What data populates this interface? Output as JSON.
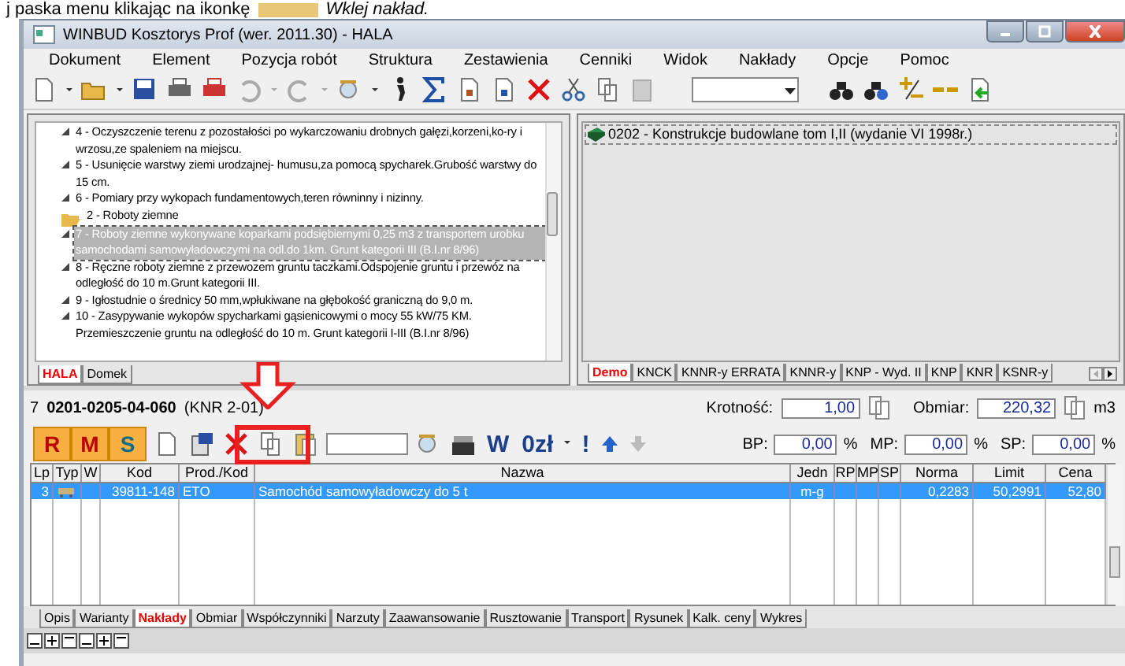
{
  "caption": {
    "before": "j paska menu klikając na ikonkę",
    "after": "Wklej nakład."
  },
  "window": {
    "title": "WINBUD Kosztorys Prof (wer. 2011.30) - HALA"
  },
  "menu": [
    "Dokument",
    "Element",
    "Pozycja robót",
    "Struktura",
    "Zestawienia",
    "Cenniki",
    "Widok",
    "Nakłady",
    "Opcje",
    "Pomoc"
  ],
  "tree": [
    {
      "kind": "item",
      "label": "4 - Oczyszczenie terenu z pozostałości po wykarczowaniu drobnych gałęzi,korzeni,ko-ry i wrzosu,ze spaleniem na miejscu.",
      "selected": false
    },
    {
      "kind": "item",
      "label": "5 - Usunięcie warstwy ziemi urodzajnej- humusu,za pomocą spycharek.Grubość warstwy do 15 cm.",
      "selected": false
    },
    {
      "kind": "item",
      "label": "6 - Pomiary przy wykopach fundamentowych,teren równinny i nizinny.",
      "selected": false
    },
    {
      "kind": "folder",
      "label": "2 - Roboty ziemne",
      "selected": false,
      "expanded": true,
      "children": [
        {
          "kind": "item",
          "label": "7 - Roboty ziemne wykonywane koparkami podsiębiernymi 0,25 m3 z transportem urobku samochodami samowyładowczymi na odl.do 1km. Grunt kategorii III (B.I.nr 8/96)",
          "selected": true
        },
        {
          "kind": "item",
          "label": "8 - Ręczne roboty ziemne z przewozem gruntu taczkami.Odspojenie gruntu i przewóz na odległość do 10 m.Grunt kategorii III.",
          "selected": false
        },
        {
          "kind": "item",
          "label": "9 - Igłostudnie o średnicy 50 mm,wpłukiwane na głębokość graniczną do 9,0 m.",
          "selected": false
        },
        {
          "kind": "item",
          "label": "10 - Zasypywanie wykopów spycharkami gąsienicowymi o mocy 55 kW/75 KM. Przemieszczenie gruntu na odległość do 10 m. Grunt kategorii I-III (B.I.nr 8/96)",
          "selected": false
        }
      ]
    }
  ],
  "left_tabs": [
    {
      "label": "HALA",
      "selected": true
    },
    {
      "label": "Domek",
      "selected": false
    }
  ],
  "catalog": {
    "label": "0202 - Konstrukcje budowlane tom I,II (wydanie VI 1998r.)"
  },
  "right_tabs": [
    {
      "label": "Demo",
      "selected": true
    },
    {
      "label": "KNCK",
      "selected": false
    },
    {
      "label": "KNNR-y ERRATA",
      "selected": false
    },
    {
      "label": "KNNR-y",
      "selected": false
    },
    {
      "label": "KNP - Wyd. II",
      "selected": false
    },
    {
      "label": "KNP",
      "selected": false
    },
    {
      "label": "KNR",
      "selected": false
    },
    {
      "label": "KSNR-y",
      "selected": false
    }
  ],
  "position": {
    "number": "7",
    "code": "0201-0205-04-060",
    "base": "(KNR 2-01)"
  },
  "krotnosc": {
    "label": "Krotność:",
    "value": "1,00"
  },
  "obmiar": {
    "label": "Obmiar:",
    "value": "220,32",
    "unit": "m3"
  },
  "rms": [
    "R",
    "M",
    "S"
  ],
  "toolbar2_texts": [
    "W",
    "0zł",
    "!"
  ],
  "percent_fields": [
    {
      "label": "BP:",
      "value": "0,00",
      "unit": "%"
    },
    {
      "label": "MP:",
      "value": "0,00",
      "unit": "%"
    },
    {
      "label": "SP:",
      "value": "0,00",
      "unit": "%"
    }
  ],
  "table": {
    "columns": [
      "Lp",
      "Typ",
      "W",
      "Kod",
      "Prod./Kod",
      "Nazwa",
      "Jedn",
      "RP",
      "MP",
      "SP",
      "Norma",
      "Limit",
      "Cena"
    ],
    "rows": [
      {
        "selected": true,
        "cells": [
          "3",
          "",
          "",
          "39811-148",
          "ETO",
          "Samochód samowyładowczy do 5 t",
          "m-g",
          "",
          "",
          "",
          "0,2283",
          "50,2991",
          "52,80"
        ]
      }
    ]
  },
  "bottom_tabs": [
    {
      "label": "Opis",
      "selected": false
    },
    {
      "label": "Warianty",
      "selected": false
    },
    {
      "label": "Nakłady",
      "selected": true
    },
    {
      "label": "Obmiar",
      "selected": false
    },
    {
      "label": "Współczynniki",
      "selected": false
    },
    {
      "label": "Narzuty",
      "selected": false
    },
    {
      "label": "Zaawansowanie",
      "selected": false
    },
    {
      "label": "Rusztowanie",
      "selected": false
    },
    {
      "label": "Transport",
      "selected": false
    },
    {
      "label": "Rysunek",
      "selected": false
    },
    {
      "label": "Kalk. ceny",
      "selected": false
    },
    {
      "label": "Wykres",
      "selected": false
    }
  ]
}
